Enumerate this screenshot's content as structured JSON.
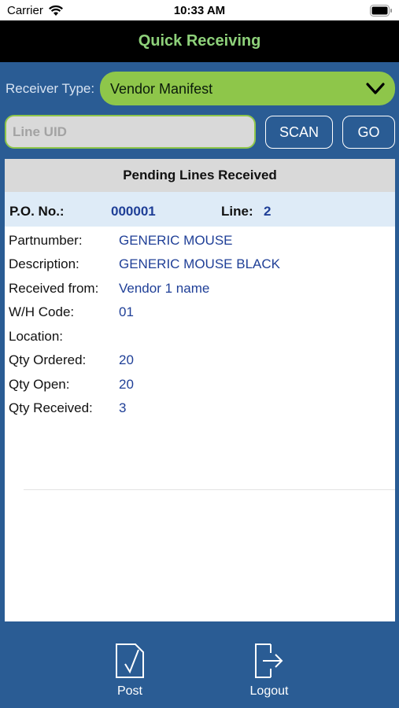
{
  "status_bar": {
    "carrier": "Carrier",
    "time": "10:33 AM"
  },
  "nav": {
    "title": "Quick Receiving"
  },
  "receiver": {
    "label": "Receiver Type:",
    "value": "Vendor Manifest"
  },
  "line_uid": {
    "placeholder": "Line UID",
    "value": ""
  },
  "buttons": {
    "scan": "SCAN",
    "go": "GO"
  },
  "card": {
    "header": "Pending Lines Received",
    "po_label": "P.O. No.:",
    "po_value": "000001",
    "line_label": "Line:",
    "line_value": "2",
    "details": [
      {
        "label": "Partnumber:",
        "value": "GENERIC MOUSE"
      },
      {
        "label": "Description:",
        "value": "GENERIC MOUSE BLACK"
      },
      {
        "label": "Received from:",
        "value": "Vendor 1 name"
      },
      {
        "label": "W/H Code:",
        "value": "01"
      },
      {
        "label": "Location:",
        "value": ""
      },
      {
        "label": "Qty Ordered:",
        "value": "20"
      },
      {
        "label": "Qty Open:",
        "value": "20"
      },
      {
        "label": "Qty Received:",
        "value": "3"
      }
    ]
  },
  "toolbar": {
    "post_label": "Post",
    "logout_label": "Logout",
    "post_icon": "document-check-icon",
    "logout_icon": "logout-icon"
  },
  "colors": {
    "background": "#2a5c94",
    "nav_bar": "#000000",
    "nav_title": "#8ed17a",
    "accent_green": "#8ec64a",
    "value_blue": "#1f3f97",
    "po_row_bg": "#deebf7",
    "card_header_bg": "#d9d9d9"
  }
}
